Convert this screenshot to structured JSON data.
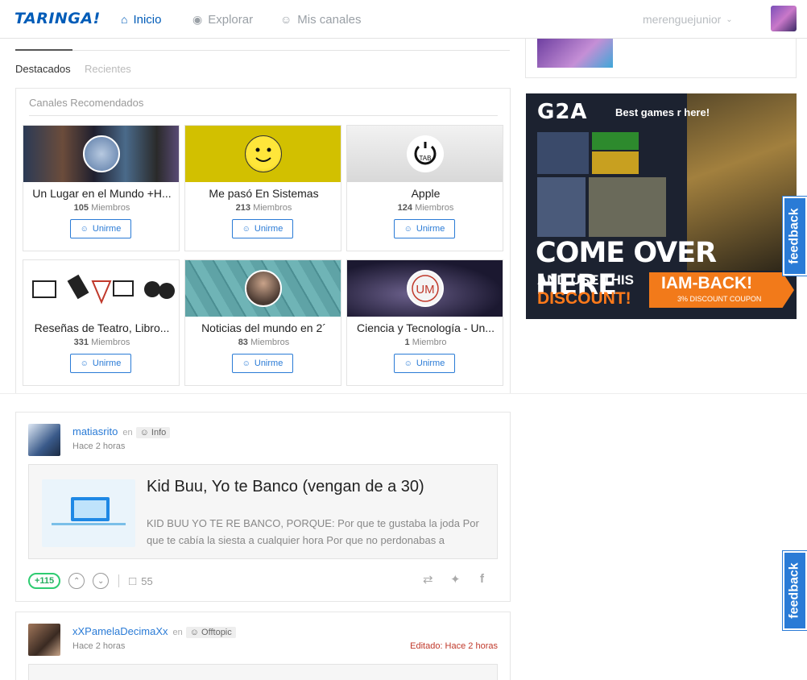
{
  "header": {
    "logo": "TARINGA!",
    "nav": [
      {
        "label": "Inicio",
        "icon": "home-icon",
        "active": true
      },
      {
        "label": "Explorar",
        "icon": "compass-icon",
        "active": false
      },
      {
        "label": "Mis canales",
        "icon": "channels-icon",
        "active": false
      }
    ],
    "username": "merenguejunior"
  },
  "tabs": {
    "featured": "Destacados",
    "recent": "Recientes"
  },
  "channels": {
    "title": "Canales Recomendados",
    "join_label": "Unirme",
    "items": [
      {
        "name": "Un Lugar en el Mundo +H...",
        "count": "105",
        "members_label": "Miembros"
      },
      {
        "name": "Me pasó En Sistemas",
        "count": "213",
        "members_label": "Miembros"
      },
      {
        "name": "Apple",
        "count": "124",
        "members_label": "Miembros"
      },
      {
        "name": "Reseñas de Teatro, Libro...",
        "count": "331",
        "members_label": "Miembros"
      },
      {
        "name": "Noticias del mundo en 2´",
        "count": "83",
        "members_label": "Miembros"
      },
      {
        "name": "Ciencia y Tecnología - Un...",
        "count": "1",
        "members_label": "Miembro"
      }
    ]
  },
  "posts": [
    {
      "user": "matiasrito",
      "in_label": "en",
      "tag": "Info",
      "time": "Hace 2 horas",
      "title": "Kid Buu, Yo te Banco (vengan de a 30)",
      "excerpt": "KID BUU YO TE RE BANCO, PORQUE: Por que te gustaba la joda Por que te cabía la siesta a cualquier hora Por que no perdonabas a",
      "score": "+115",
      "comments": "55"
    },
    {
      "user": "xXPamelaDecimaXx",
      "in_label": "en",
      "tag": "Offtopic",
      "time": "Hace 2 horas",
      "edited": "Editado: Hace 2 horas"
    }
  ],
  "ad": {
    "logo": "G2A",
    "tagline": "Best games r here!",
    "headline": "COME OVER HERE",
    "line2": "AND USE THIS",
    "line3": "DISCOUNT!",
    "code": "IAM-BACK!",
    "code_sub": "3% DISCOUNT COUPON"
  },
  "feedback_label": "feedback",
  "colors": {
    "brand": "#005cb8",
    "link": "#2a7bd6",
    "score": "#2ecc71",
    "edited": "#c0392b"
  }
}
